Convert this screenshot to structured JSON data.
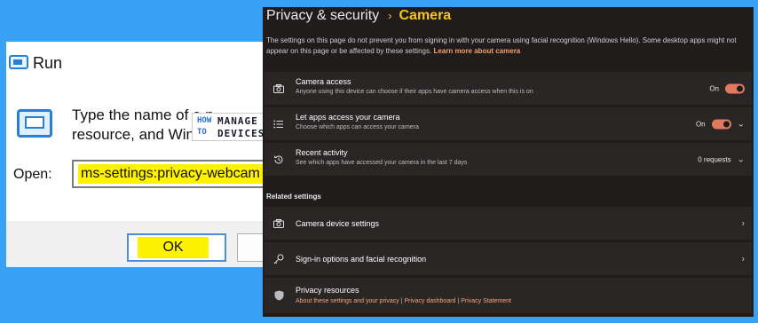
{
  "run_dialog": {
    "title": "Run",
    "description_line1": "Type the name of a p",
    "description_line2": "resource, and Windo",
    "open_label": "Open:",
    "input_value": "ms-settings:privacy-webcam",
    "ok_label": "OK"
  },
  "watermark": {
    "how": "HOW",
    "to": "TO",
    "manage": "MANAGE",
    "devices": "DEVICES"
  },
  "settings": {
    "breadcrumb_parent": "Privacy & security",
    "breadcrumb_separator": "›",
    "breadcrumb_current": "Camera",
    "intro_text": "The settings on this page do not prevent you from signing in with your camera using facial recognition (Windows Hello). Some desktop apps might not appear on this page or be affected by these settings.",
    "intro_link": "Learn more about camera",
    "rows": [
      {
        "title": "Camera access",
        "subtitle": "Anyone using this device can choose if their apps have camera access when this is on",
        "state": "On"
      },
      {
        "title": "Let apps access your camera",
        "subtitle": "Choose which apps can access your camera",
        "state": "On"
      },
      {
        "title": "Recent activity",
        "subtitle": "See which apps have accessed your camera in the last 7 days",
        "value": "0 requests"
      }
    ],
    "related_heading": "Related settings",
    "related": [
      {
        "title": "Camera device settings"
      },
      {
        "title": "Sign-in options and facial recognition"
      }
    ],
    "privacy_resources": {
      "title": "Privacy resources",
      "link1": "About these settings and your privacy",
      "sep": "|",
      "link2": "Privacy dashboard",
      "link3": "Privacy Statement"
    },
    "accent_color": "#f5c518",
    "toggle_color": "#e07a5f"
  }
}
